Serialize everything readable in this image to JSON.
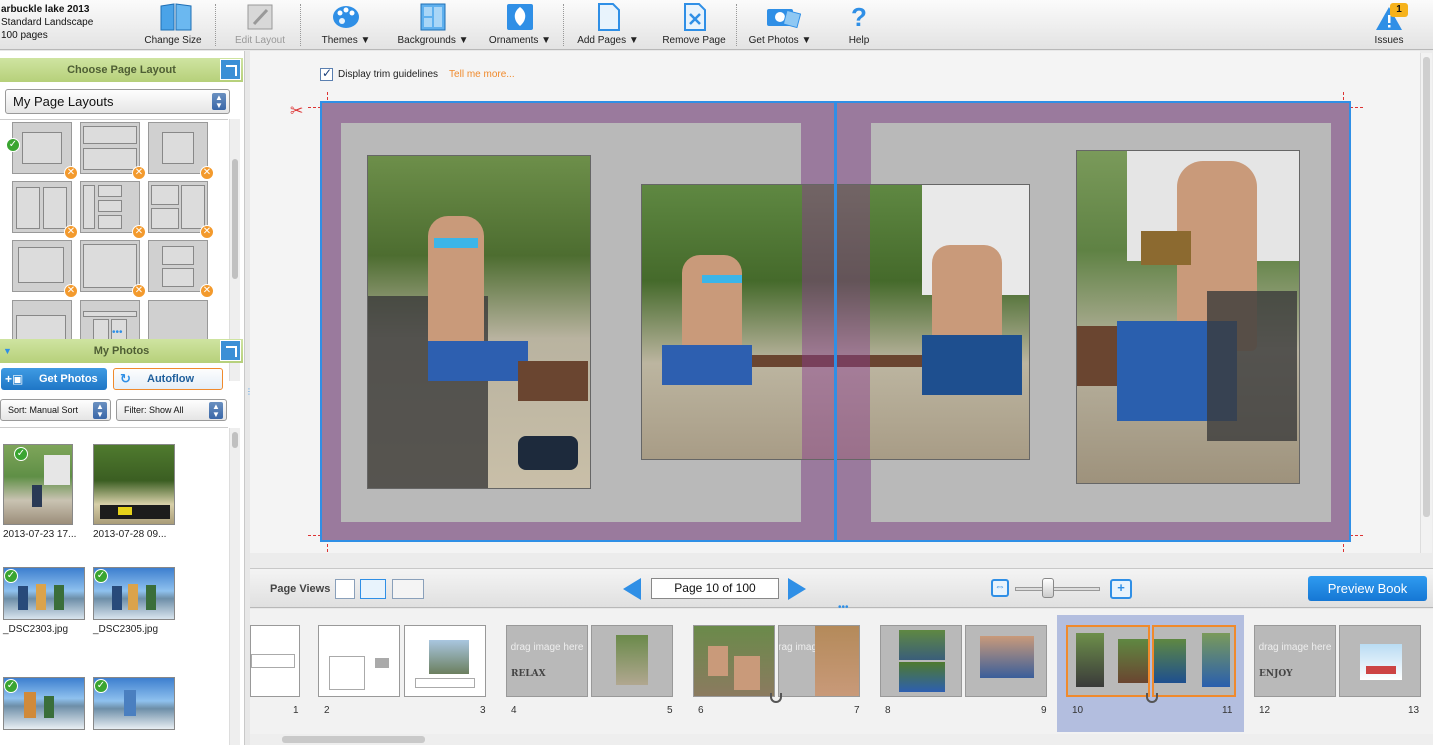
{
  "book": {
    "title": "arbuckle lake 2013",
    "format": "Standard Landscape",
    "pages": "100 pages"
  },
  "toolbar": {
    "change_size": "Change Size",
    "edit_layout": "Edit Layout",
    "themes": "Themes ▼",
    "backgrounds": "Backgrounds ▼",
    "ornaments": "Ornaments ▼",
    "add_pages": "Add Pages ▼",
    "remove_page": "Remove Page",
    "get_photos": "Get Photos ▼",
    "help": "Help",
    "issues": "Issues",
    "issues_count": "1"
  },
  "layouts_panel": {
    "title": "Choose Page Layout",
    "selected": "My Page Layouts"
  },
  "photos_panel": {
    "title": "My Photos",
    "get_photos": "Get Photos",
    "autoflow": "Autoflow",
    "sort": "Sort:  Manual Sort",
    "filter": "Filter:  Show All",
    "items": [
      {
        "caption": "2013-07-23 17...",
        "used": true
      },
      {
        "caption": "2013-07-28 09...",
        "used": false
      },
      {
        "caption": "_DSC2303.jpg",
        "used": true
      },
      {
        "caption": "_DSC2305.jpg",
        "used": true
      },
      {
        "caption": "",
        "used": true
      },
      {
        "caption": "",
        "used": true
      }
    ]
  },
  "canvas": {
    "trim_label": "Display trim guidelines",
    "tell_me": "Tell me more..."
  },
  "views": {
    "label": "Page Views",
    "page_indicator": "Page 10 of 100",
    "preview": "Preview Book"
  },
  "filmstrip": {
    "drag_text": "drag image here",
    "relax": "RELAX",
    "enjoy": "ENJOY",
    "page_numbers": [
      "1",
      "2",
      "3",
      "4",
      "5",
      "6",
      "7",
      "8",
      "9",
      "10",
      "11",
      "12",
      "13"
    ]
  },
  "colors": {
    "accent": "#2f8fe6",
    "panel_green": "#b6d07a",
    "warning": "#f39a2d",
    "spread_purple": "#9a7a9d"
  }
}
